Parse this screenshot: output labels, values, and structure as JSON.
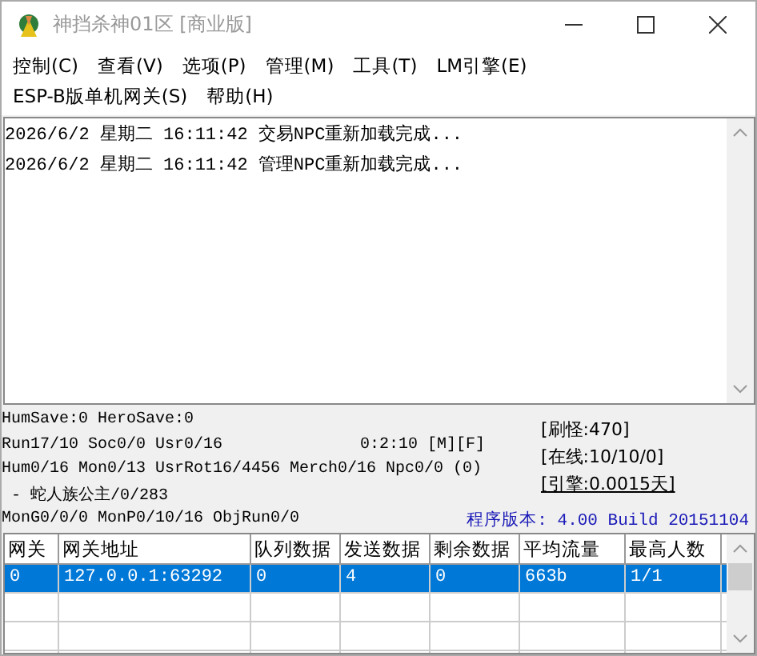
{
  "window": {
    "title": "神挡杀神01区 [商业版]"
  },
  "menu": [
    "控制(C)",
    "查看(V)",
    "选项(P)",
    "管理(M)",
    "工具(T)",
    "LM引擎(E)",
    "ESP-B版单机网关(S)",
    "帮助(H)"
  ],
  "log": [
    "2026/6/2 星期二 16:11:42 交易NPC重新加载完成...",
    "2026/6/2 星期二 16:11:42 管理NPC重新加载完成..."
  ],
  "status": {
    "lines": [
      {
        "text": "HumSave:0 HeroSave:0"
      },
      {
        "text": "Run17/10 Soc0/0 Usr0/16",
        "aside": "0:2:10 [M][F]"
      },
      {
        "text": "Hum0/16 Mon0/13 UsrRot16/4456 Merch0/16 Npc0/0 (0)"
      },
      {
        "text": " - 蛇人族公主/0/283"
      },
      {
        "text": "MonG0/0/0 MonP0/10/16 ObjRun0/0"
      }
    ],
    "info": [
      {
        "text": "[刷怪:470]",
        "underlined": false
      },
      {
        "text": "[在线:10/10/0]",
        "underlined": false
      },
      {
        "text": "[引擎:0.0015天]",
        "underlined": true
      }
    ],
    "version": "程序版本: 4.00 Build 20151104"
  },
  "table": {
    "columns": [
      "网关",
      "网关地址",
      "队列数据",
      "发送数据",
      "剩余数据",
      "平均流量",
      "最高人数"
    ],
    "rows": [
      {
        "cells": [
          "0",
          "127.0.0.1:63292",
          "0",
          "4",
          "0",
          "663b",
          "1/1"
        ],
        "selected": true
      }
    ]
  }
}
